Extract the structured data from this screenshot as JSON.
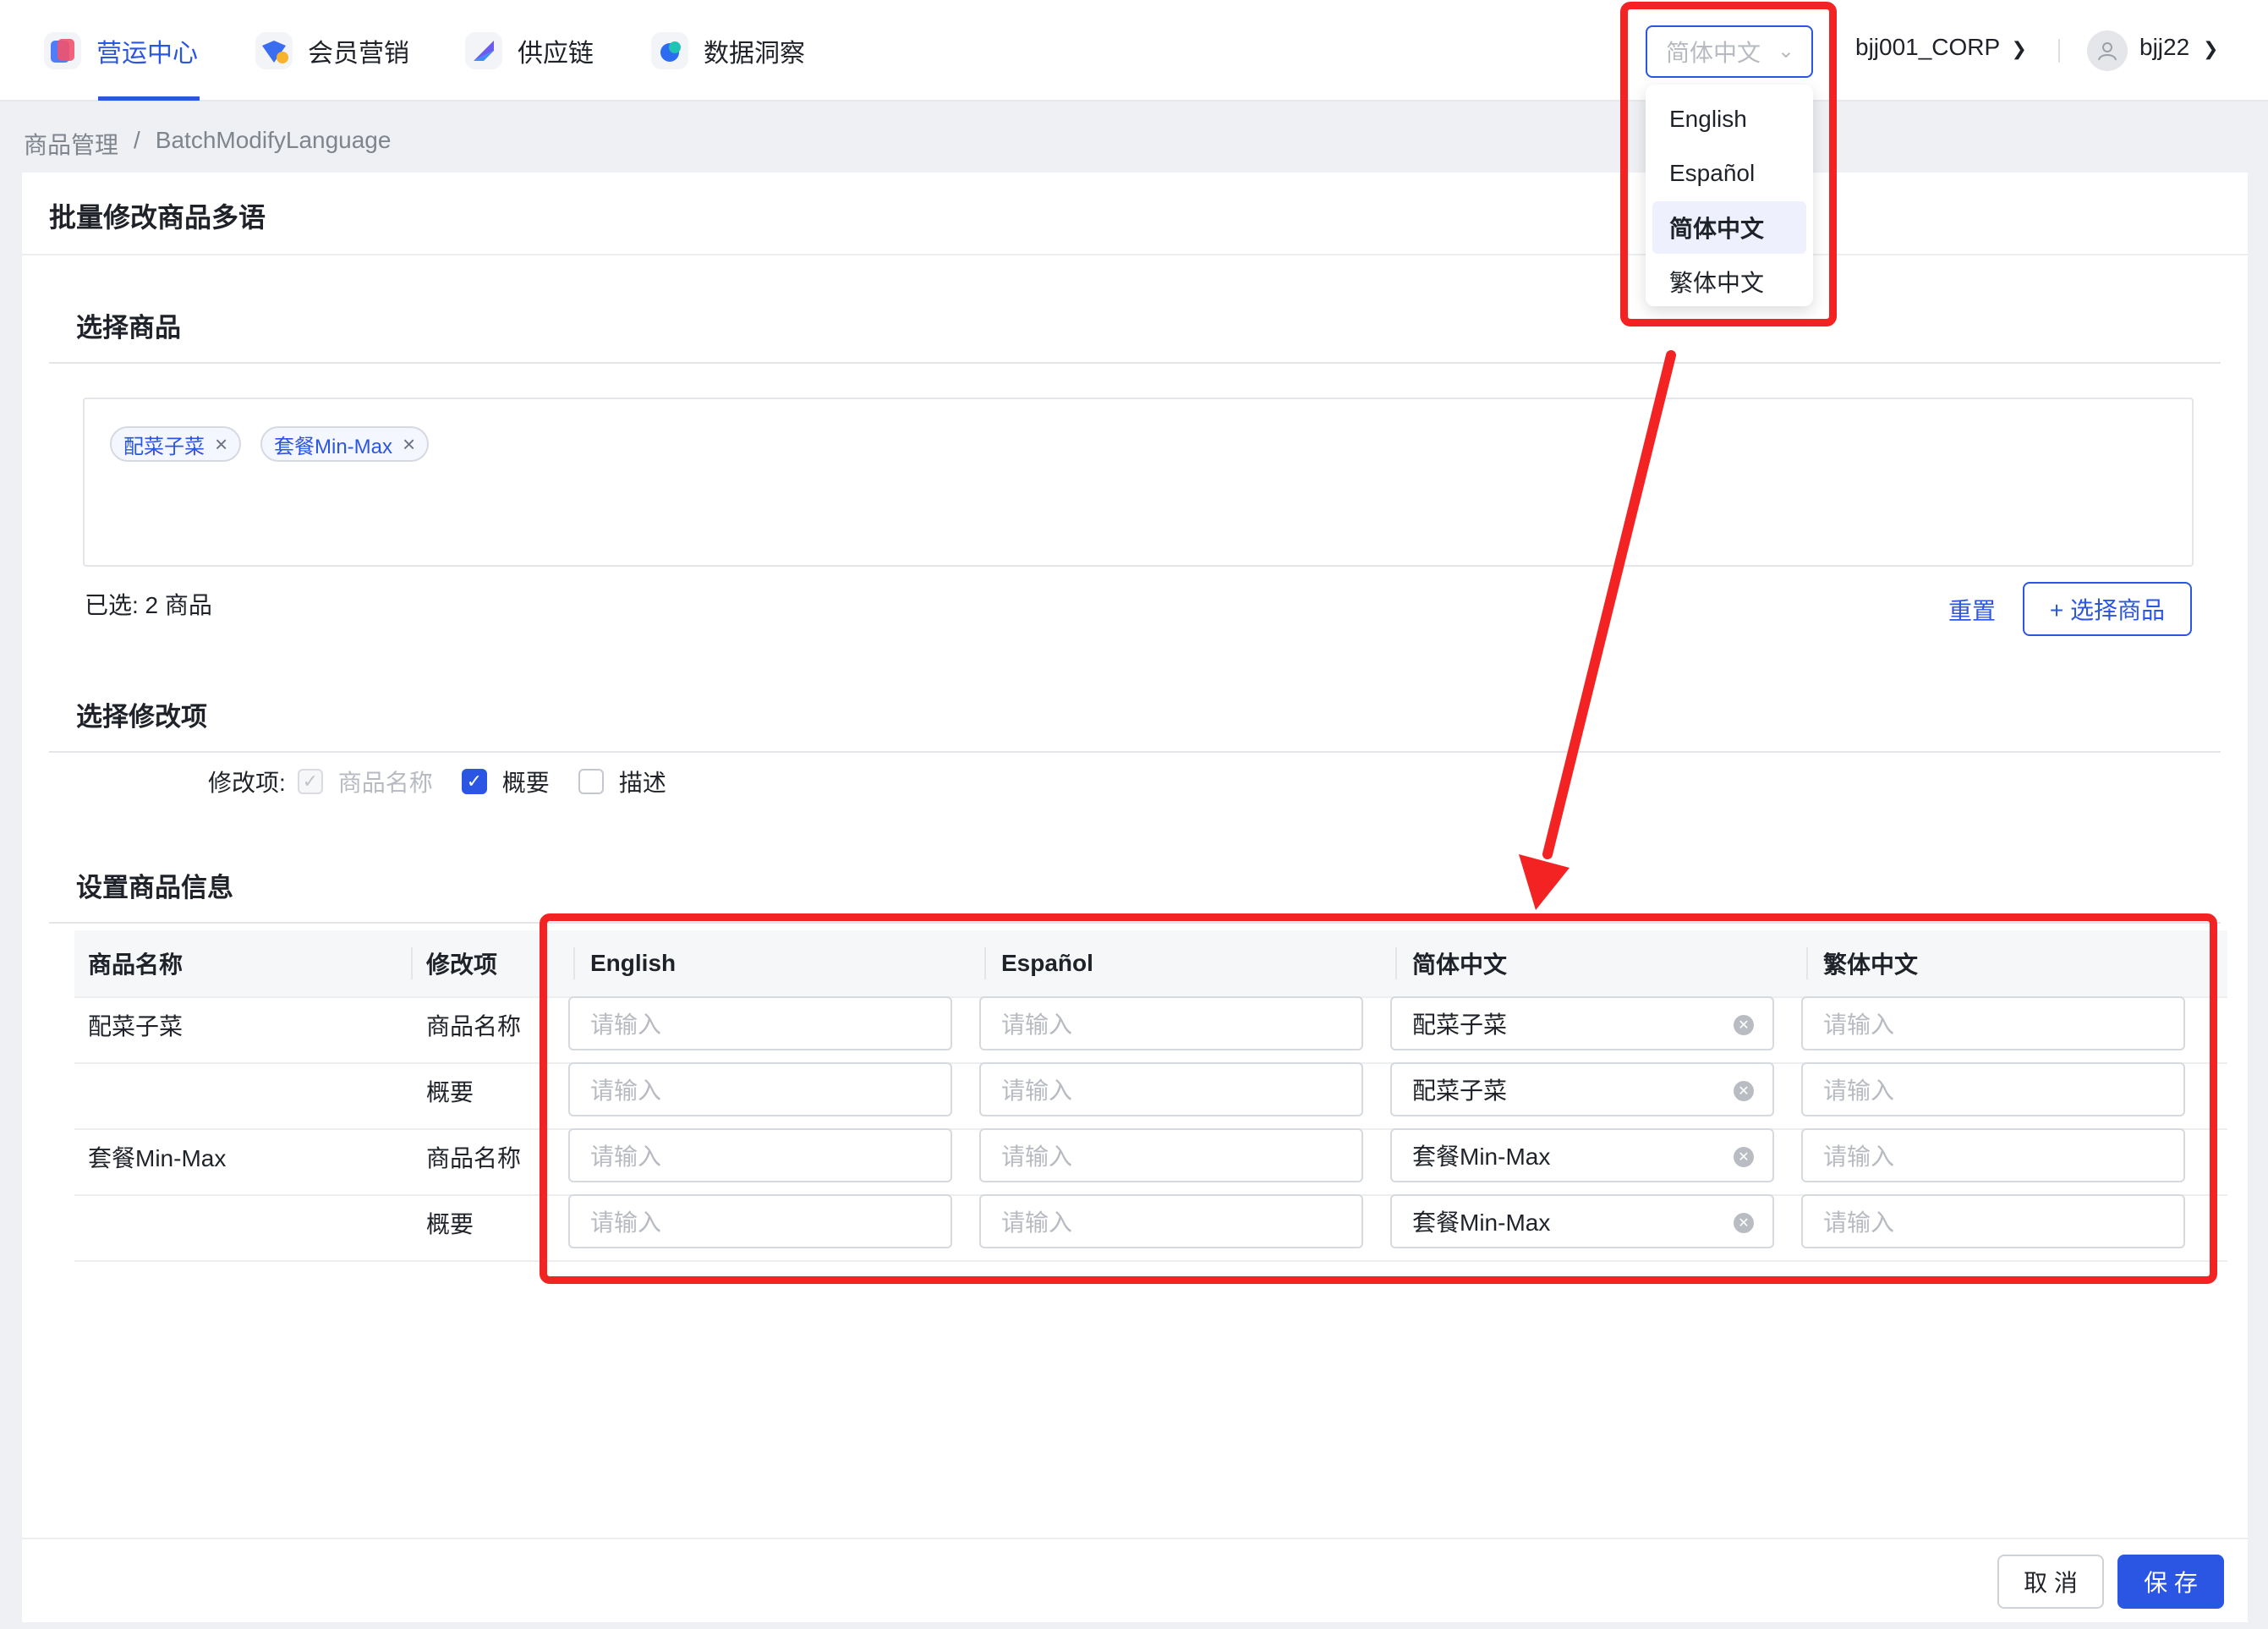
{
  "nav": {
    "items": [
      {
        "label": "营运中心",
        "icon": "operations-icon",
        "active": true
      },
      {
        "label": "会员营销",
        "icon": "member-marketing-icon",
        "active": false
      },
      {
        "label": "供应链",
        "icon": "supply-chain-icon",
        "active": false
      },
      {
        "label": "数据洞察",
        "icon": "data-insight-icon",
        "active": false
      }
    ],
    "language_select": "简体中文",
    "corp": "bjj001_CORP",
    "username": "bjj22"
  },
  "language_menu": {
    "options": [
      "English",
      "Español",
      "简体中文",
      "繁体中文"
    ],
    "selected": "简体中文"
  },
  "breadcrumb": {
    "parent": "商品管理",
    "separator": "/",
    "current": "BatchModifyLanguage"
  },
  "page": {
    "title": "批量修改商品多语",
    "select_products": {
      "title": "选择商品",
      "tags": [
        "配菜子菜",
        "套餐Min-Max"
      ],
      "tag_close": "×",
      "selected_count": "已选: 2 商品",
      "reset_label": "重置",
      "select_button": "+ 选择商品"
    },
    "modify_items": {
      "title": "选择修改项",
      "label": "修改项:",
      "options": [
        {
          "label": "商品名称",
          "checked": true,
          "disabled": true
        },
        {
          "label": "概要",
          "checked": true,
          "disabled": false
        },
        {
          "label": "描述",
          "checked": false,
          "disabled": false
        }
      ]
    },
    "product_info": {
      "title": "设置商品信息",
      "headers": [
        "商品名称",
        "修改项",
        "English",
        "Español",
        "简体中文",
        "繁体中文"
      ],
      "placeholder": "请输入",
      "rows": [
        {
          "product": "配菜子菜",
          "item": "商品名称",
          "en": "",
          "es": "",
          "zh_hans": "配菜子菜",
          "zh_hant": ""
        },
        {
          "product": "",
          "item": "概要",
          "en": "",
          "es": "",
          "zh_hans": "配菜子菜",
          "zh_hant": ""
        },
        {
          "product": "套餐Min-Max",
          "item": "商品名称",
          "en": "",
          "es": "",
          "zh_hans": "套餐Min-Max",
          "zh_hant": ""
        },
        {
          "product": "",
          "item": "概要",
          "en": "",
          "es": "",
          "zh_hans": "套餐Min-Max",
          "zh_hant": ""
        }
      ]
    },
    "footer": {
      "cancel": "取 消",
      "save": "保 存"
    }
  },
  "colors": {
    "accent": "#2b55e3",
    "annotation": "#f42323"
  }
}
